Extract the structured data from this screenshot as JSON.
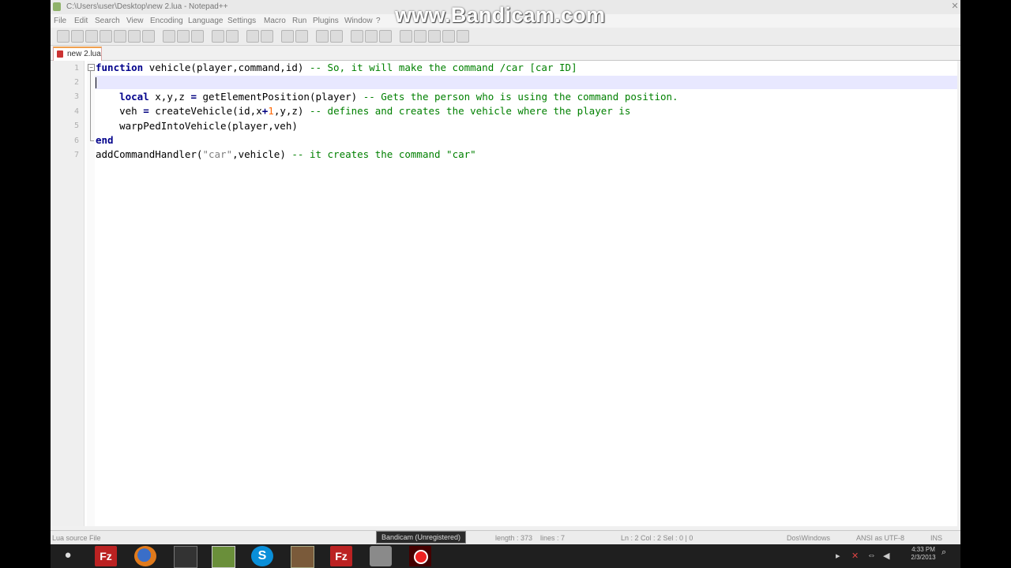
{
  "window": {
    "title": "C:\\Users\\user\\Desktop\\new 2.lua - Notepad++",
    "close_glyph": "✕"
  },
  "menu": [
    "File",
    "Edit",
    "Search",
    "View",
    "Encoding",
    "Language",
    "Settings",
    "Macro",
    "Run",
    "Plugins",
    "Window",
    "?"
  ],
  "watermark": "www.Bandicam.com",
  "tab": {
    "label": "new 2.lua"
  },
  "editor": {
    "line_numbers": [
      "1",
      "2",
      "3",
      "4",
      "5",
      "6",
      "7"
    ]
  },
  "status": {
    "file_type": "Lua source File",
    "length": "length : 373",
    "lines": "lines : 7",
    "position": "Ln : 2   Col : 2   Sel : 0 | 0",
    "eol": "Dos\\Windows",
    "encoding": "ANSI as UTF-8",
    "mode": "INS"
  },
  "taskbar": {
    "tooltip": "Bandicam (Unregistered)",
    "clock_time": "4:33 PM",
    "clock_date": "2/3/2013"
  },
  "colors": {
    "keyword": "#00008b",
    "comment": "#008000",
    "string": "#808080",
    "number": "#ff6600",
    "current_line": "#e8e8ff"
  }
}
